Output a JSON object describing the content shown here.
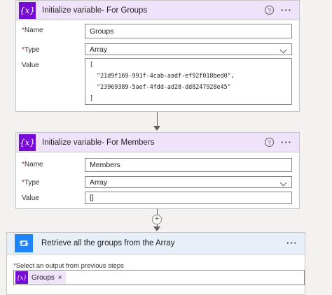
{
  "card1": {
    "title": "Initialize variable- For Groups",
    "icon": "variable-icon",
    "name_label": "Name",
    "name_value": "Groups",
    "type_label": "Type",
    "type_value": "Array",
    "value_label": "Value",
    "value_lines": [
      "[",
      "  \"21d9f169-991f-4cab-aadf-ef92f018bed0\",",
      "  \"23969389-5aef-4fdd-ad28-dd8247928e45\"",
      "]"
    ]
  },
  "card2": {
    "title": "Initialize variable- For Members",
    "icon": "variable-icon",
    "name_label": "Name",
    "name_value": "Members",
    "type_label": "Type",
    "type_value": "Array",
    "value_label": "Value",
    "value_value": "[]"
  },
  "card3": {
    "title": "Retrieve all the groups from the Array",
    "icon": "loop-icon",
    "output_label": "Select an output from previous steps",
    "token_label": "Groups",
    "token_close": "×"
  },
  "common": {
    "required_mark": "*",
    "help_glyph": "?",
    "more_glyph": "···",
    "variable_glyph": "{x}",
    "plus_glyph": "+"
  },
  "colors": {
    "variable_purple": "#770bd6",
    "variable_header_bg": "#efe3fb",
    "loop_blue": "#1f85ff",
    "loop_header_bg": "#e7f0f8",
    "required_red": "#a4262c"
  }
}
